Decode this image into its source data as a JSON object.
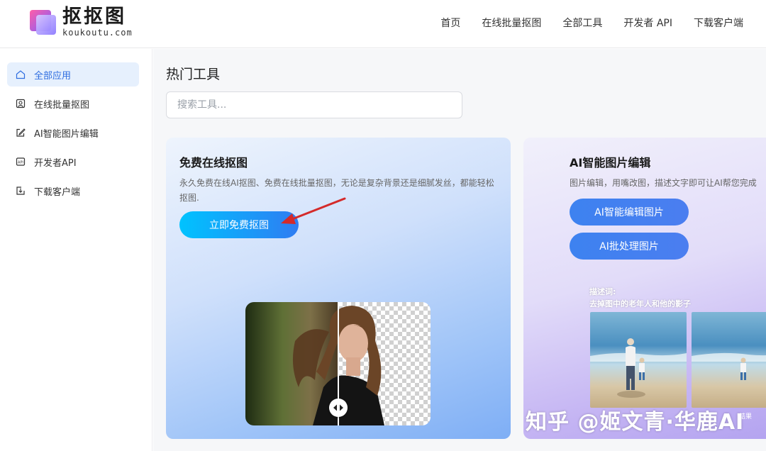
{
  "brand": {
    "name_cn": "抠抠图",
    "domain": "koukoutu.com"
  },
  "header": {
    "nav": [
      "首页",
      "在线批量抠图",
      "全部工具",
      "开发者 API",
      "下载客户端"
    ]
  },
  "sidebar": {
    "items": [
      {
        "label": "全部应用",
        "icon": "home-icon",
        "active": true
      },
      {
        "label": "在线批量抠图",
        "icon": "portrait-icon",
        "active": false
      },
      {
        "label": "AI智能图片编辑",
        "icon": "edit-icon",
        "active": false
      },
      {
        "label": "开发者API",
        "icon": "api-icon",
        "active": false
      },
      {
        "label": "下载客户端",
        "icon": "download-icon",
        "active": false
      }
    ]
  },
  "main": {
    "title": "热门工具",
    "search": {
      "placeholder": "搜索工具...",
      "value": ""
    },
    "cards": [
      {
        "title": "免费在线抠图",
        "desc": "永久免费在线AI抠图、免费在线批量抠图，无论是复杂背景还是细腻发丝，都能轻松抠图.",
        "buttons": [
          "立即免费抠图"
        ]
      },
      {
        "title": "AI智能图片编辑",
        "desc": "图片编辑，用嘴改图，描述文字即可让AI帮您完成",
        "buttons": [
          "AI智能编辑图片",
          "AI批处理图片"
        ],
        "sample_label_1": "描述词:",
        "sample_label_2": "去掉图中的老年人和他的影子",
        "sample_tag": "结果"
      }
    ]
  },
  "watermark": "知乎 @姬文青·华鹿AI",
  "colors": {
    "accent": "#2e6de0",
    "active_bg": "#e6f0fd",
    "arrow": "#d42a2a"
  }
}
